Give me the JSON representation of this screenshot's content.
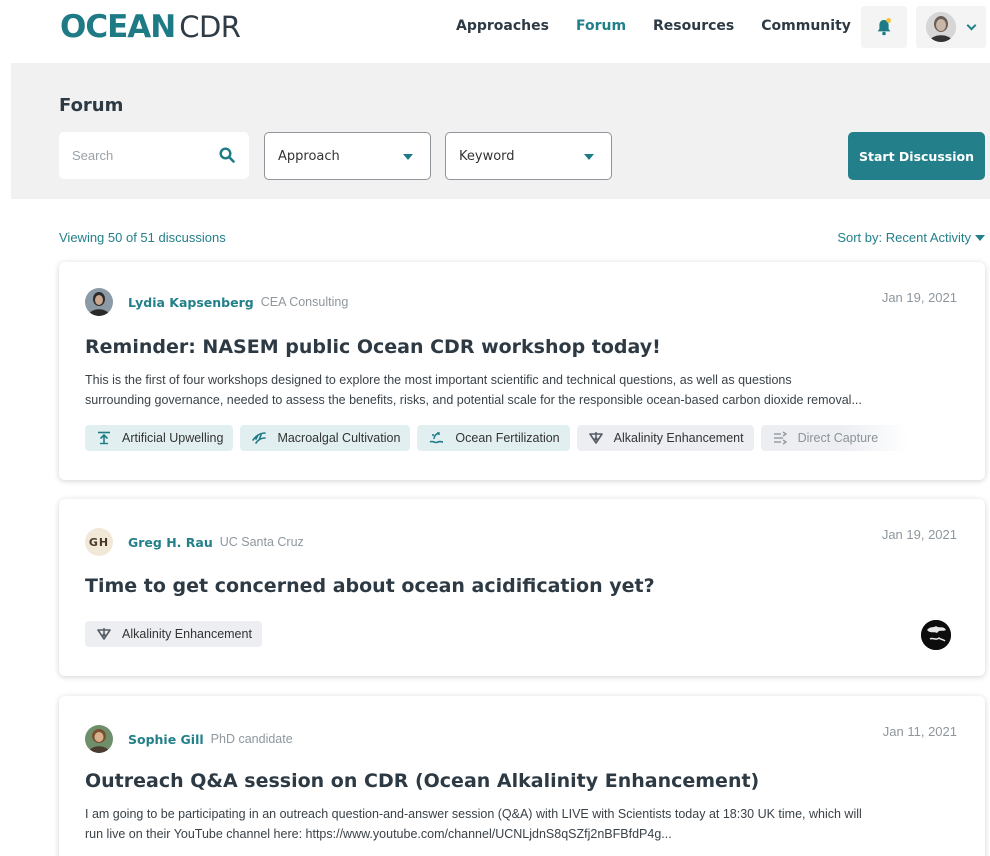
{
  "header": {
    "logo": {
      "ocean": "OCEAN",
      "cdr": "CDR"
    },
    "nav": [
      {
        "label": "Approaches"
      },
      {
        "label": "Forum"
      },
      {
        "label": "Resources"
      },
      {
        "label": "Community"
      }
    ],
    "colors": {
      "accent": "#23808a",
      "dark": "#2d3a44",
      "bell": "#1e7b86",
      "bell_dot": "#f3c23a"
    }
  },
  "filters": {
    "page_title": "Forum",
    "search_placeholder": "Search",
    "approach_label": "Approach",
    "keyword_label": "Keyword",
    "start_button": "Start Discussion"
  },
  "list": {
    "viewing_text": "Viewing 50 of 51 discussions",
    "sort_label": "Sort by: Recent Activity"
  },
  "posts": [
    {
      "author": "Lydia Kapsenberg",
      "org": "CEA Consulting",
      "date": "Jan 19, 2021",
      "title": "Reminder: NASEM public Ocean CDR workshop today!",
      "excerpt_line1": "This is the first of four workshops designed to explore the most important scientific and technical questions, as well as questions",
      "excerpt_line2": "surrounding governance, needed to assess the benefits, risks, and potential scale for the responsible ocean-based carbon dioxide removal...",
      "tags": [
        {
          "label": "Artificial Upwelling",
          "icon": "upwelling-icon"
        },
        {
          "label": "Macroalgal Cultivation",
          "icon": "seaweed-icon"
        },
        {
          "label": "Ocean Fertilization",
          "icon": "fertilization-icon"
        },
        {
          "label": "Alkalinity Enhancement",
          "icon": "alkalinity-icon"
        },
        {
          "label": "Direct Capture",
          "icon": "direct-capture-icon"
        }
      ]
    },
    {
      "author": "Greg H. Rau",
      "initials": "GH",
      "org": "UC Santa Cruz",
      "date": "Jan 19, 2021",
      "title": "Time to get concerned about ocean acidification yet?",
      "tags": [
        {
          "label": "Alkalinity Enhancement",
          "icon": "alkalinity-icon"
        }
      ]
    },
    {
      "author": "Sophie Gill",
      "org": "PhD candidate",
      "date": "Jan 11, 2021",
      "title": "Outreach Q&A session on CDR (Ocean Alkalinity Enhancement)",
      "excerpt_line1": "I am going to be participating in an outreach question-and-answer session (Q&A) with LIVE with Scientists today at 18:30 UK time, which will",
      "excerpt_line2": "run live on their YouTube channel here: https://www.youtube.com/channel/UCNLjdnS8qSZfj2nBFBfdP4g..."
    }
  ]
}
